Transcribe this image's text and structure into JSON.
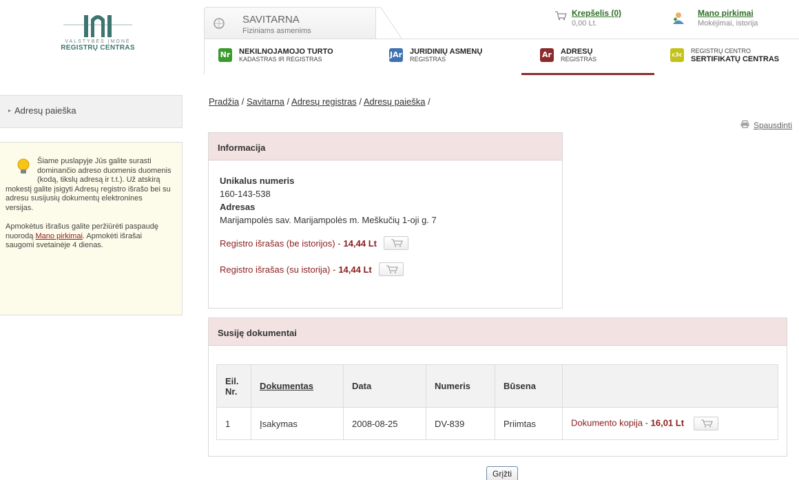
{
  "logo": {
    "line1": "VALSTYBĖS ĮMONĖ",
    "line2": "REGISTRŲ CENTRAS"
  },
  "header": {
    "savitarna": {
      "title": "SAVITARNA",
      "subtitle": "Fiziniams asmenims"
    },
    "cart": {
      "label": "Krepšelis (0)",
      "amount": "0,00 Lt."
    },
    "purchases": {
      "label": "Mano pirkimai",
      "subtitle": "Mokėjimai, istorija"
    },
    "registers": [
      {
        "badge": "Nr",
        "name": "NEKILNOJAMOJO TURTO",
        "sub": "KADASTRAS IR REGISTRAS",
        "color": "#3a9a2d"
      },
      {
        "badge": "JAr",
        "name": "JURIDINIŲ ASMENŲ",
        "sub": "REGISTRAS",
        "color": "#3e72b0"
      },
      {
        "badge": "Ar",
        "name": "ADRESŲ",
        "sub": "REGISTRAS",
        "color": "#8b2a2a",
        "active": true
      },
      {
        "badge": "c3c",
        "name": "SERTIFIKATŲ CENTRAS",
        "sub_top": "REGISTRŲ CENTRO",
        "color": "#c2c21a"
      }
    ]
  },
  "sidebar": {
    "menu_label": "Adresų paieška",
    "info_p1": "Šiame puslapyje Jūs galite surasti dominančio adreso duomenis duomenis (kodą, tikslų adresą ir t.t.). Už atskirą mokestį galite įsigyti Adresų registro išrašo bei su adresu susijusių dokumentų elektronines versijas.",
    "info_p2_before": "Apmokėtus išrašus galite peržiūrėti paspaudę nuorodą ",
    "info_p2_link": "Mano pirkimai",
    "info_p2_after": ". Apmokėti išrašai saugomi svetainėje 4 dienas."
  },
  "breadcrumb": {
    "items": [
      "Pradžia",
      "Savitarna",
      "Adresų registras",
      "Adresų paieška"
    ],
    "separator": "/"
  },
  "print_label": "Spausdinti",
  "info": {
    "title": "Informacija",
    "unique_label": "Unikalus numeris",
    "unique_value": "160-143-538",
    "address_label": "Adresas",
    "address_value": "Marijampolės sav. Marijampolės m. Meškučių 1-oji g. 7",
    "extract1_label": "Registro išrašas (be istorijos) -",
    "extract1_price": "14,44 Lt",
    "extract2_label": "Registro išrašas (su istorija) -",
    "extract2_price": "14,44 Lt"
  },
  "docs": {
    "title": "Susiję dokumentai",
    "headers": {
      "nr": "Eil. Nr.",
      "doc": "Dokumentas",
      "date": "Data",
      "num": "Numeris",
      "status": "Būsena",
      "buy": ""
    },
    "rows": [
      {
        "nr": "1",
        "doc": "Įsakymas",
        "date": "2008-08-25",
        "num": "DV-839",
        "status": "Priimtas",
        "buy_label": "Dokumento kopija -",
        "buy_price": "16,01 Lt"
      }
    ]
  },
  "back_button": "Grįžti"
}
